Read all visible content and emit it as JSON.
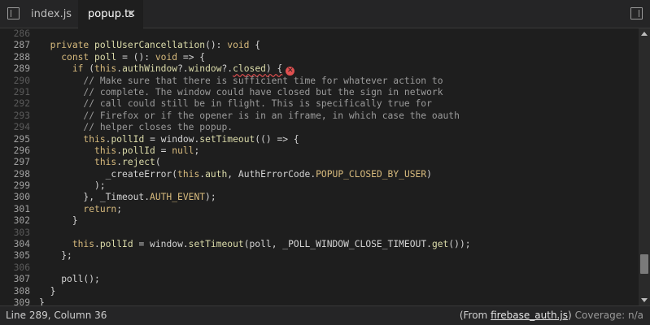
{
  "tabs": [
    {
      "label": "index.js",
      "active": false
    },
    {
      "label": "popup.ts",
      "active": true,
      "close_glyph": "✕"
    }
  ],
  "editor": {
    "lines": [
      {
        "n": "286",
        "dim": true,
        "html": ""
      },
      {
        "n": "287",
        "dim": false,
        "html": "  <span class=\"kw\">private</span> <span class=\"fn\">pollUserCancellation</span>(): <span class=\"kw\">void</span> {"
      },
      {
        "n": "288",
        "dim": false,
        "html": "    <span class=\"kw\">const</span> <span class=\"fn\">poll</span> = (): <span class=\"kw\">void</span> => {"
      },
      {
        "n": "289",
        "dim": false,
        "html": "      <span class=\"kw\">if</span> (<span class=\"kw\">this</span>.<span class=\"fn\">authWindow</span>?.<span class=\"fn\">window</span>?.<span class=\"squig\"><span class=\"fn\">closed</span>) {</span><span class=\"err-icon\" data-name=\"error-icon\" data-interactable=\"true\">✕</span>"
      },
      {
        "n": "290",
        "dim": true,
        "html": "        <span class=\"cm\">// Make sure that there is sufficient time for whatever action to</span>"
      },
      {
        "n": "291",
        "dim": true,
        "html": "        <span class=\"cm\">// complete. The window could have closed but the sign in network</span>"
      },
      {
        "n": "292",
        "dim": true,
        "html": "        <span class=\"cm\">// call could still be in flight. This is specifically true for</span>"
      },
      {
        "n": "293",
        "dim": true,
        "html": "        <span class=\"cm\">// Firefox or if the opener is in an iframe, in which case the oauth</span>"
      },
      {
        "n": "294",
        "dim": true,
        "html": "        <span class=\"cm\">// helper closes the popup.</span>"
      },
      {
        "n": "295",
        "dim": false,
        "html": "        <span class=\"kw\">this</span>.<span class=\"fn\">pollId</span> = window.<span class=\"fn\">setTimeout</span>(() => {"
      },
      {
        "n": "296",
        "dim": false,
        "html": "          <span class=\"kw\">this</span>.<span class=\"fn\">pollId</span> = <span class=\"kw\">null</span>;"
      },
      {
        "n": "297",
        "dim": false,
        "html": "          <span class=\"kw\">this</span>.<span class=\"fn\">reject</span>("
      },
      {
        "n": "298",
        "dim": false,
        "html": "            _createError(<span class=\"kw\">this</span>.<span class=\"fn\">auth</span>, AuthErrorCode.<span class=\"con\">POPUP_CLOSED_BY_USER</span>)"
      },
      {
        "n": "299",
        "dim": false,
        "html": "          );"
      },
      {
        "n": "300",
        "dim": false,
        "html": "        }, _Timeout.<span class=\"con\">AUTH_EVENT</span>);"
      },
      {
        "n": "301",
        "dim": false,
        "html": "        <span class=\"kw\">return</span>;"
      },
      {
        "n": "302",
        "dim": false,
        "html": "      }"
      },
      {
        "n": "303",
        "dim": true,
        "html": ""
      },
      {
        "n": "304",
        "dim": false,
        "html": "      <span class=\"kw\">this</span>.<span class=\"fn\">pollId</span> = window.<span class=\"fn\">setTimeout</span>(poll, _POLL_WINDOW_CLOSE_TIMEOUT.<span class=\"fn\">get</span>());"
      },
      {
        "n": "305",
        "dim": false,
        "html": "    };"
      },
      {
        "n": "306",
        "dim": true,
        "html": ""
      },
      {
        "n": "307",
        "dim": false,
        "html": "    poll();"
      },
      {
        "n": "308",
        "dim": false,
        "html": "  }"
      },
      {
        "n": "309",
        "dim": false,
        "html": "}"
      }
    ]
  },
  "status": {
    "position": "Line 289, Column 36",
    "from_prefix": "(From ",
    "from_file": "firebase_auth.js",
    "from_suffix": ")",
    "coverage": "Coverage: n/a"
  }
}
